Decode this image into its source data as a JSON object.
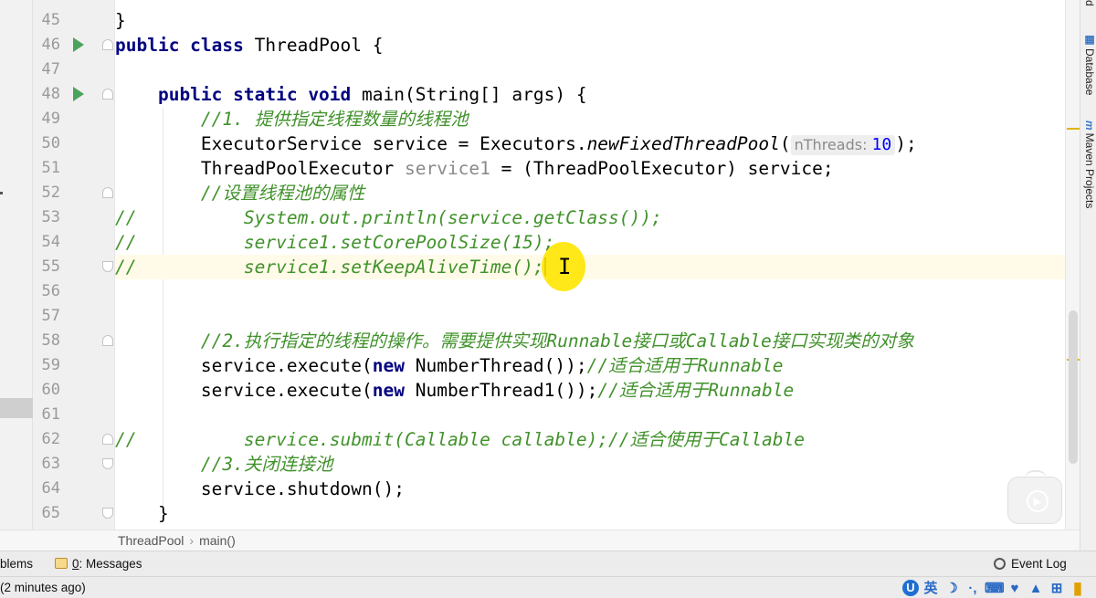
{
  "editor": {
    "lines": [
      {
        "num": "45",
        "kind": "plain",
        "segments": [
          {
            "t": "}",
            "c": ""
          }
        ]
      },
      {
        "num": "46",
        "kind": "run",
        "segments": [
          {
            "t": "public class ",
            "c": "kw"
          },
          {
            "t": "ThreadPool {",
            "c": ""
          }
        ]
      },
      {
        "num": "47",
        "kind": "plain",
        "segments": []
      },
      {
        "num": "48",
        "kind": "run",
        "segments": [
          {
            "t": "    public static void ",
            "c": "kw"
          },
          {
            "t": "main(String[] args) {",
            "c": ""
          }
        ]
      },
      {
        "num": "49",
        "kind": "plain",
        "segments": [
          {
            "t": "        //1. 提供指定线程数量的线程池",
            "c": "cm"
          }
        ]
      },
      {
        "num": "50",
        "kind": "plain",
        "segments": [
          {
            "t": "        ExecutorService service = Executors.",
            "c": ""
          },
          {
            "t": "newFixedThreadPool",
            "c": "ss"
          },
          {
            "t": "(",
            "c": ""
          },
          {
            "t": "nThreads: ",
            "c": "hint",
            "v": "10"
          },
          {
            "t": ");",
            "c": ""
          }
        ]
      },
      {
        "num": "51",
        "kind": "plain",
        "segments": [
          {
            "t": "        ThreadPoolExecutor ",
            "c": ""
          },
          {
            "t": "service1",
            "c": "gray"
          },
          {
            "t": " = (ThreadPoolExecutor) service;",
            "c": ""
          }
        ]
      },
      {
        "num": "52",
        "kind": "plain",
        "segments": [
          {
            "t": "        //设置线程池的属性",
            "c": "cm"
          }
        ]
      },
      {
        "num": "53",
        "kind": "plain",
        "segments": [
          {
            "t": "//          System.out.println(service.getClass());",
            "c": "cm"
          }
        ]
      },
      {
        "num": "54",
        "kind": "plain",
        "segments": [
          {
            "t": "//          service1.setCorePoolSize(15);",
            "c": "cm"
          }
        ]
      },
      {
        "num": "55",
        "kind": "current",
        "segments": [
          {
            "t": "//          service1.setKeepAliveTime();",
            "c": "cm"
          },
          {
            "t": "",
            "c": "caret"
          }
        ]
      },
      {
        "num": "56",
        "kind": "plain",
        "segments": []
      },
      {
        "num": "57",
        "kind": "plain",
        "segments": []
      },
      {
        "num": "58",
        "kind": "plain",
        "segments": [
          {
            "t": "        //2.执行指定的线程的操作。需要提供实现Runnable接口或Callable接口实现类的对象",
            "c": "cm"
          }
        ]
      },
      {
        "num": "59",
        "kind": "plain",
        "segments": [
          {
            "t": "        service.execute(",
            "c": ""
          },
          {
            "t": "new ",
            "c": "kw"
          },
          {
            "t": "NumberThread());",
            "c": ""
          },
          {
            "t": "//适合适用于Runnable",
            "c": "cm"
          }
        ]
      },
      {
        "num": "60",
        "kind": "plain",
        "segments": [
          {
            "t": "        service.execute(",
            "c": ""
          },
          {
            "t": "new ",
            "c": "kw"
          },
          {
            "t": "NumberThread1());",
            "c": ""
          },
          {
            "t": "//适合适用于Runnable",
            "c": "cm"
          }
        ]
      },
      {
        "num": "61",
        "kind": "plain",
        "segments": []
      },
      {
        "num": "62",
        "kind": "plain",
        "segments": [
          {
            "t": "//          service.submit(Callable callable);//适合使用于Callable",
            "c": "cm"
          }
        ]
      },
      {
        "num": "63",
        "kind": "plain",
        "segments": [
          {
            "t": "        //3.关闭连接池",
            "c": "cm"
          }
        ]
      },
      {
        "num": "64",
        "kind": "plain",
        "segments": [
          {
            "t": "        service.shutdown();",
            "c": ""
          }
        ]
      },
      {
        "num": "65",
        "kind": "plain",
        "segments": [
          {
            "t": "    }",
            "c": ""
          }
        ]
      }
    ],
    "folds": [
      {
        "line": "46",
        "type": "close"
      },
      {
        "line": "48",
        "type": "close"
      },
      {
        "line": "52",
        "type": "close"
      },
      {
        "line": "55",
        "type": "open"
      },
      {
        "line": "58",
        "type": "close"
      },
      {
        "line": "62",
        "type": "close"
      },
      {
        "line": "63",
        "type": "open"
      },
      {
        "line": "65",
        "type": "open"
      }
    ]
  },
  "breadcrumb": {
    "file": "ThreadPool",
    "method": "main()"
  },
  "right_tools": {
    "database": "Database",
    "database_icon": "database-icon",
    "maven": "Maven Projects",
    "maven_icon": "maven-icon",
    "top_fragment": "d"
  },
  "toolwindows": {
    "problems": "blems",
    "messages_num": "0",
    "messages_label": ": Messages",
    "event_log": "Event Log"
  },
  "status": {
    "message": "(2 minutes ago)"
  },
  "ime": {
    "lang": "英",
    "items": [
      "moon-icon",
      "punctuation-icon",
      "keyboard-icon",
      "skin-icon",
      "shirt-icon",
      "grid-icon"
    ]
  },
  "colors": {
    "keyword": "#000080",
    "comment": "#41922b",
    "number": "#0000ff",
    "run_gutter": "#4aa35d",
    "current_line": "#fffbe8",
    "cursor_highlight": "#ffe600"
  }
}
